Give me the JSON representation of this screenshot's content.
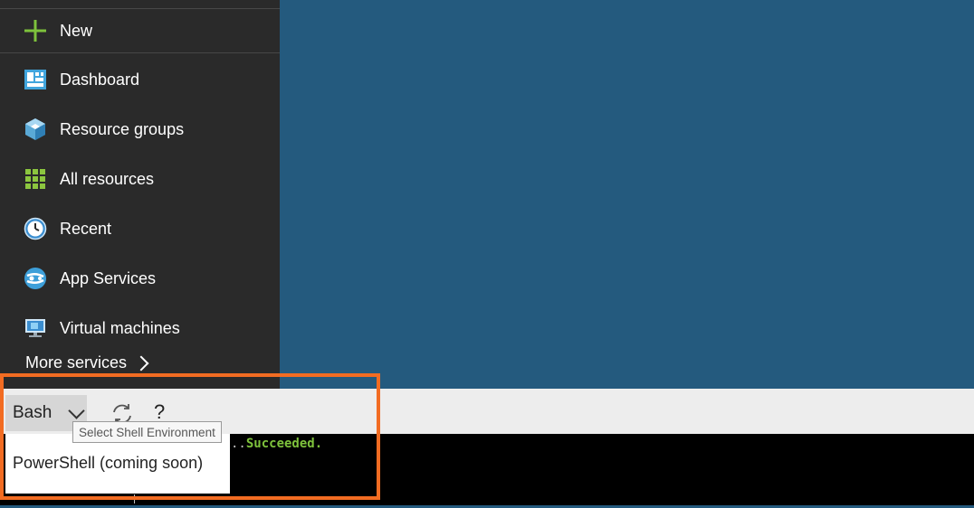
{
  "sidebar": {
    "new_label": "New",
    "items": [
      {
        "label": "Dashboard",
        "icon": "dashboard-icon"
      },
      {
        "label": "Resource groups",
        "icon": "resource-groups-icon"
      },
      {
        "label": "All resources",
        "icon": "all-resources-icon"
      },
      {
        "label": "Recent",
        "icon": "clock-icon"
      },
      {
        "label": "App Services",
        "icon": "app-services-icon"
      },
      {
        "label": "Virtual machines",
        "icon": "virtual-machines-icon"
      }
    ],
    "more_label": "More services"
  },
  "shell": {
    "selected": "Bash",
    "tooltip": "Select Shell Environment",
    "options": [
      "PowerShell (coming soon)"
    ],
    "help_label": "?",
    "terminal_prefix": "..",
    "terminal_status": "Succeeded."
  },
  "colors": {
    "sidebar_bg": "#2a2a2a",
    "main_bg": "#245a7e",
    "highlight": "#f26c22",
    "success": "#7ec23c"
  }
}
